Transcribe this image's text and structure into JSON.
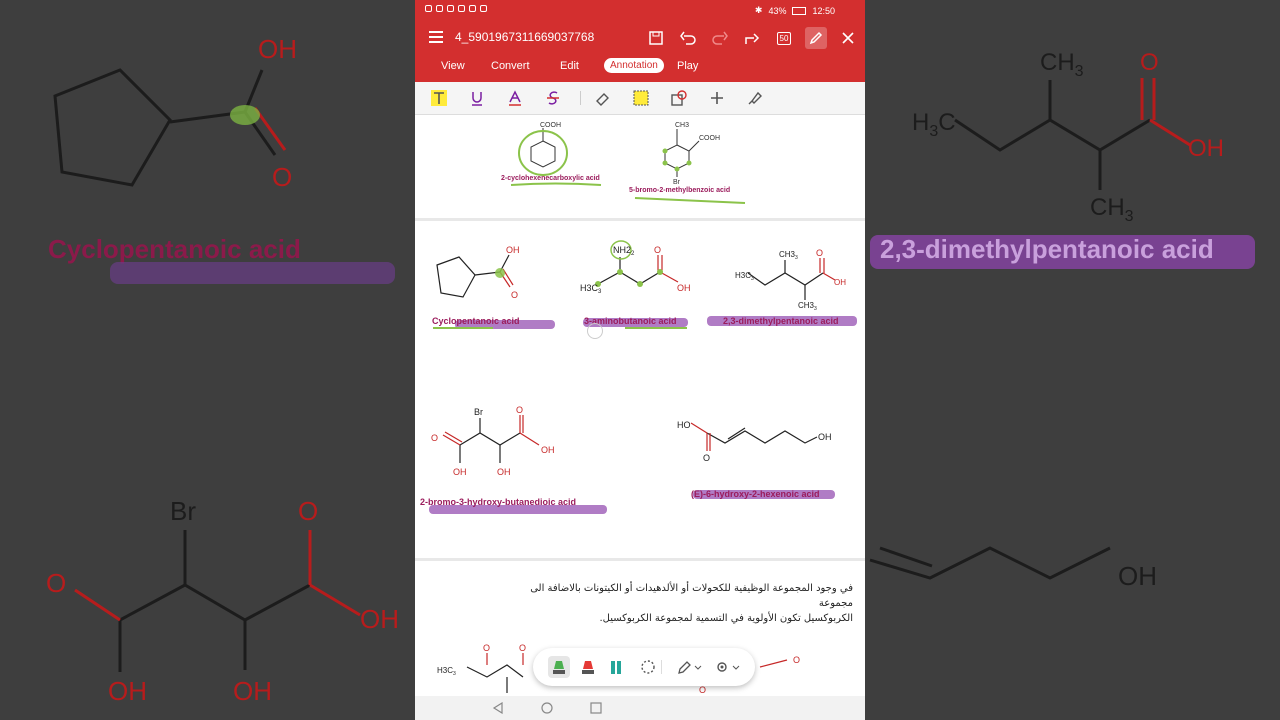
{
  "status": {
    "battery": "43%",
    "time": "12:50"
  },
  "toolbar": {
    "filename": "4_5901967311669037768",
    "page_count_label": "50"
  },
  "tabs": [
    {
      "label": "View"
    },
    {
      "label": "Convert"
    },
    {
      "label": "Edit"
    },
    {
      "label": "Annotation"
    },
    {
      "label": "Play"
    }
  ],
  "annotation_tools": [
    "text-highlight",
    "underline",
    "text-color",
    "strikethrough",
    "eraser",
    "area-highlight",
    "shape",
    "add",
    "stamp"
  ],
  "document": {
    "top_labels": [
      "2-cyclohexenecarboxylic acid",
      "5-bromo-2-methylbenzoic acid"
    ],
    "top_atoms": {
      "cooh1": "COOH",
      "ch3": "CH3",
      "cooh2": "COOH",
      "br": "Br"
    },
    "row1": {
      "cyclopentanoic": "Cyclopentanoic acid",
      "aminobutanoic": "3-aminobutanoic acid",
      "dimethylpentanoic": "2,3-dimethylpentanoic acid"
    },
    "atoms": {
      "oh": "OH",
      "o": "O",
      "nh2": "NH2",
      "h3c": "H3C",
      "ch3": "CH3",
      "h3c_sub": "3",
      "ch3_sub": "3",
      "nh2_sub": "2",
      "br": "Br",
      "ho": "HO"
    },
    "row2": {
      "bromo": "2-bromo-3-hydroxy-butanedioic acid",
      "hexenoic": "(E)-6-hydroxy-2-hexenoic acid"
    },
    "arabic_line1": "في وجود المجموعة الوظيفية للكحولات أو الألدهيدات أو الكيتونات بالاضافة الى مجموعة",
    "arabic_line2": "الكربوكسيل تكون الأولوية في التسمية لمجموعة الكربوكسيل."
  },
  "background": {
    "left_label": "Cyclopentanoic acid",
    "right_label": "2,3-dimethylpentanoic acid",
    "atoms": {
      "oh": "OH",
      "o": "O",
      "ch": "CH",
      "h": "H",
      "c": "C",
      "sub3": "3",
      "br": "Br"
    }
  },
  "colors": {
    "brand": "#d32f2f",
    "label": "#9b1c5c",
    "atom_red": "#c62828",
    "highlight_green": "#8bc34a",
    "highlight_purple": "#8e44ad"
  }
}
